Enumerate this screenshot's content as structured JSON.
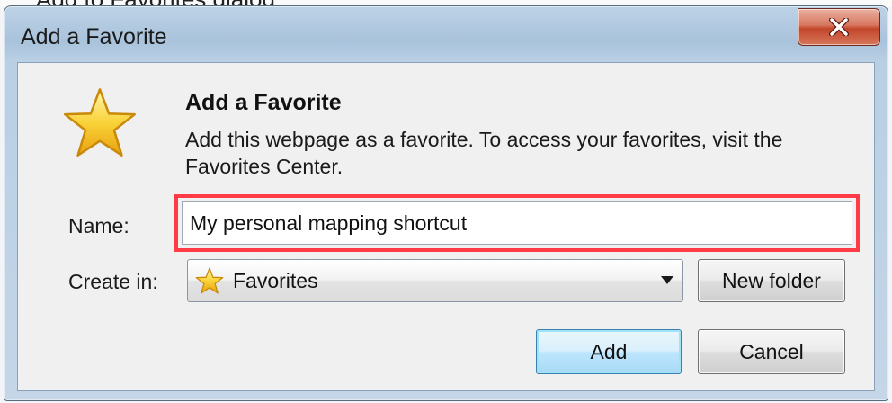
{
  "top_sliver_text": "Add to Favorites dialog",
  "window": {
    "title": "Add a Favorite",
    "close_symbol": "✕"
  },
  "header": {
    "heading": "Add a Favorite",
    "description": "Add this webpage as a favorite. To access your favorites, visit the Favorites Center.",
    "icon": "star-icon"
  },
  "form": {
    "name_label": "Name:",
    "name_value": "My personal mapping shortcut",
    "create_in_label": "Create in:",
    "create_in_value": "Favorites",
    "create_in_icon": "star-icon"
  },
  "buttons": {
    "new_folder": "New folder",
    "add": "Add",
    "cancel": "Cancel"
  },
  "colors": {
    "highlight": "#ff3b46",
    "close_button": "#c3452b",
    "default_button_glow": "#9ee3f8",
    "star_fill": "#f6c324"
  }
}
